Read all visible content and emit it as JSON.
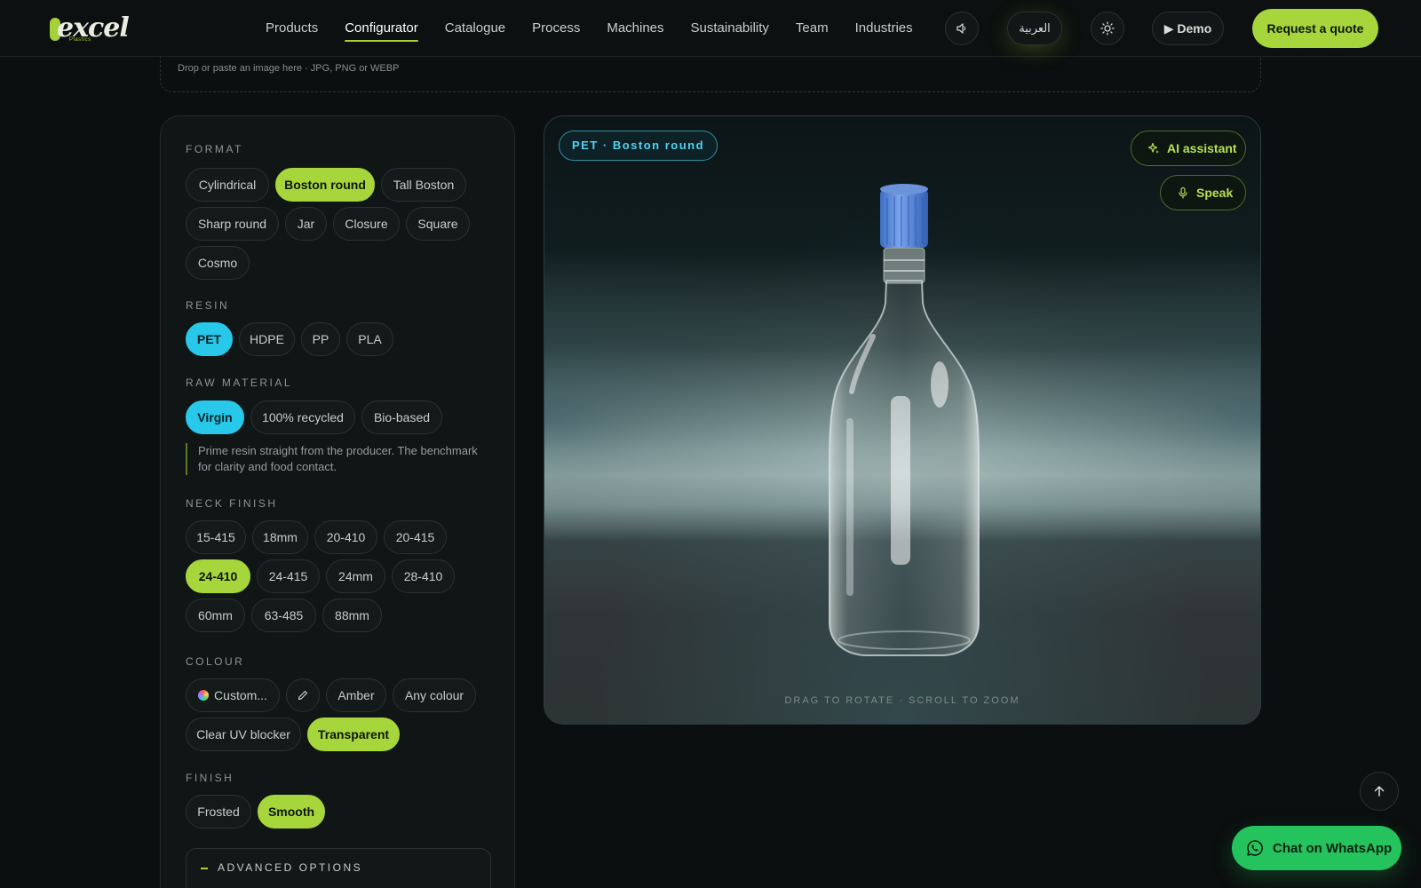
{
  "header": {
    "logo_word": "excel",
    "logo_sub": "Plastics",
    "nav": [
      "Products",
      "Configurator",
      "Catalogue",
      "Process",
      "Machines",
      "Sustainability",
      "Team",
      "Industries"
    ],
    "lang_label": "العربية",
    "demo_label": "▶ Demo",
    "quote_label": "Request a quote"
  },
  "dropzone": {
    "hint": "Drop or paste an image here · JPG, PNG or WEBP"
  },
  "panel": {
    "format": {
      "label": "FORMAT",
      "options": [
        "Cylindrical",
        "Boston round",
        "Tall Boston",
        "Sharp round",
        "Jar",
        "Closure",
        "Square",
        "Cosmo"
      ],
      "selected": "Boston round"
    },
    "resin": {
      "label": "RESIN",
      "options": [
        "PET",
        "HDPE",
        "PP",
        "PLA"
      ],
      "selected": "PET"
    },
    "raw_material": {
      "label": "RAW MATERIAL",
      "options": [
        "Virgin",
        "100% recycled",
        "Bio-based"
      ],
      "selected": "Virgin",
      "description": "Prime resin straight from the producer. The benchmark for clarity and food contact."
    },
    "neck_finish": {
      "label": "NECK FINISH",
      "options": [
        "15-415",
        "18mm",
        "20-410",
        "20-415",
        "24-410",
        "24-415",
        "24mm",
        "28-410",
        "60mm",
        "63-485",
        "88mm"
      ],
      "selected": "24-410"
    },
    "colour": {
      "label": "COLOUR",
      "options": [
        "Custom...",
        "Amber",
        "Any colour",
        "Clear UV blocker",
        "Transparent"
      ],
      "selected": "Transparent"
    },
    "finish": {
      "label": "FINISH",
      "options": [
        "Frosted",
        "Smooth"
      ],
      "selected": "Smooth"
    },
    "advanced": {
      "label": "ADVANCED OPTIONS"
    }
  },
  "viewer": {
    "tag": "PET · Boston round",
    "ai_label": "AI assistant",
    "speak_label": "Speak",
    "hint": "DRAG TO ROTATE · SCROLL TO ZOOM",
    "cap_color": "#4a82d8"
  },
  "floating": {
    "whatsapp_label": "Chat on WhatsApp"
  },
  "colors": {
    "accent_lime": "#a6d63c",
    "accent_cyan": "#27c8ea",
    "whatsapp": "#25c35d"
  }
}
